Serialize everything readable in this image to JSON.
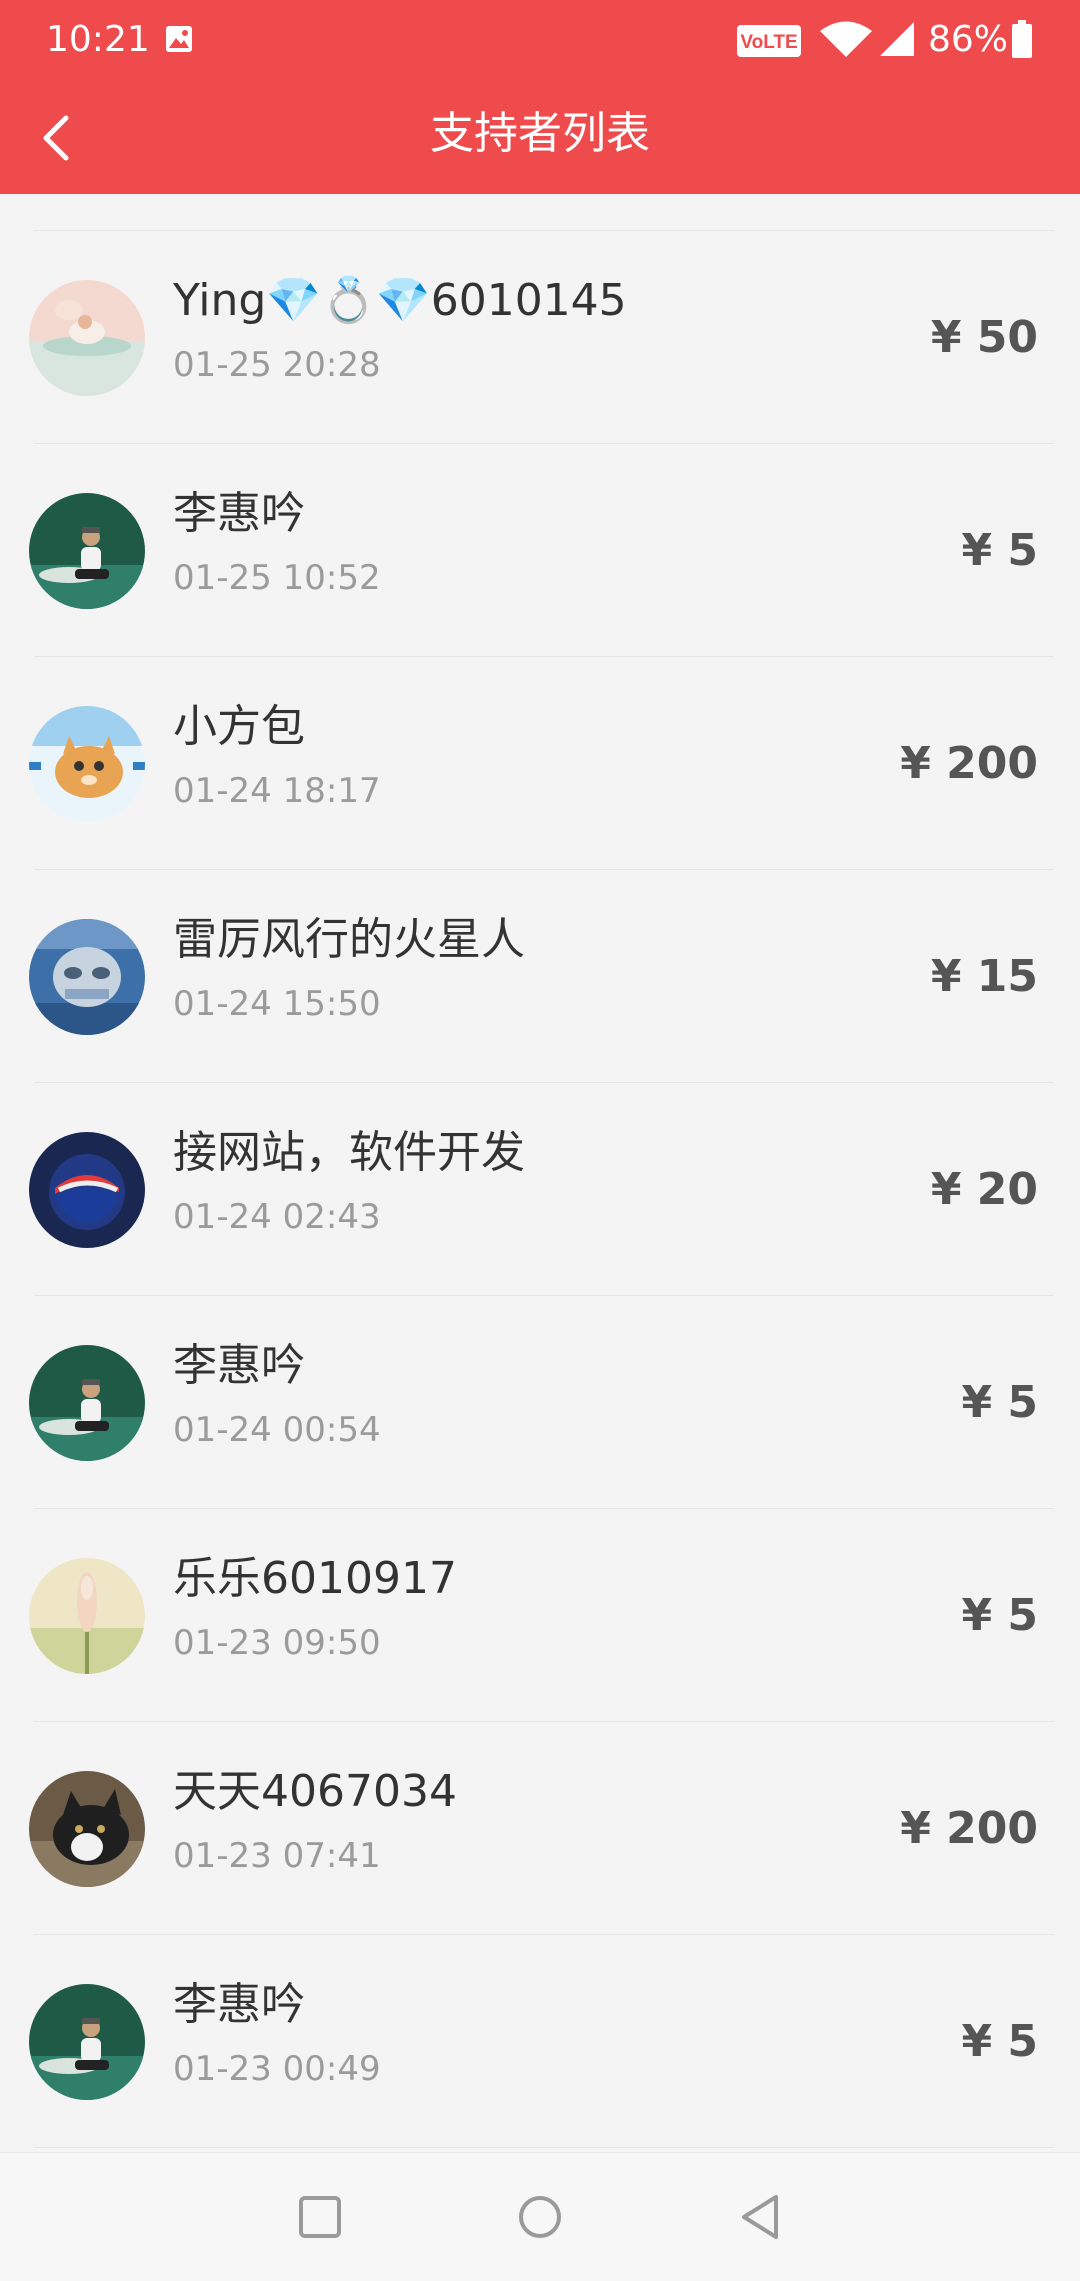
{
  "status_bar": {
    "time": "10:21",
    "volte": "VoLTE",
    "battery": "86%",
    "icons": [
      "image-icon",
      "volte-icon",
      "wifi-icon",
      "signal-icon",
      "battery-icon"
    ]
  },
  "header": {
    "title": "支持者列表",
    "back_icon": "chevron-left-icon"
  },
  "supporters": [
    {
      "name": "Ying💎💍💎6010145",
      "time": "01-25 20:28",
      "amount": "¥ 50"
    },
    {
      "name": "李惠吟",
      "time": "01-25 10:52",
      "amount": "¥ 5"
    },
    {
      "name": "小方包",
      "time": "01-24 18:17",
      "amount": "¥ 200"
    },
    {
      "name": "雷厉风行的火星人",
      "time": "01-24 15:50",
      "amount": "¥ 15"
    },
    {
      "name": "接网站，软件开发",
      "time": "01-24 02:43",
      "amount": "¥ 20"
    },
    {
      "name": "李惠吟",
      "time": "01-24 00:54",
      "amount": "¥ 5"
    },
    {
      "name": "乐乐6010917",
      "time": "01-23 09:50",
      "amount": "¥ 5"
    },
    {
      "name": "天天4067034",
      "time": "01-23 07:41",
      "amount": "¥ 200"
    },
    {
      "name": "李惠吟",
      "time": "01-23 00:49",
      "amount": "¥ 5"
    }
  ],
  "nav_bar": {
    "buttons": [
      "recents-square-icon",
      "home-circle-icon",
      "back-triangle-icon"
    ]
  },
  "colors": {
    "header_bg": "#ef4b4d",
    "page_bg": "#f4f4f4",
    "name_text": "#333333",
    "time_text": "#9b9b9b",
    "amount_text": "#555555"
  }
}
